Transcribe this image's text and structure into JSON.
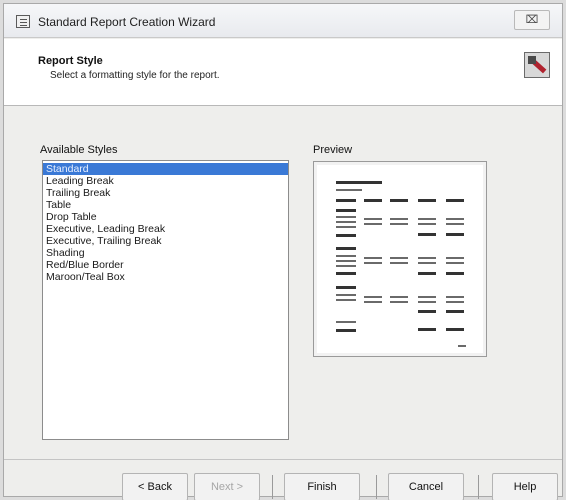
{
  "window": {
    "title": "Standard Report Creation Wizard",
    "close_label": "⌧"
  },
  "header": {
    "title": "Report Style",
    "subtitle": "Select a formatting style for the report.",
    "icon": "report-style-wand-icon"
  },
  "styles": {
    "label": "Available Styles",
    "items": [
      "Standard",
      "Leading Break",
      "Trailing Break",
      "Table",
      "Drop Table",
      "Executive, Leading Break",
      "Executive, Trailing Break",
      "Shading",
      "Red/Blue Border",
      "Maroon/Teal Box"
    ],
    "selected": "Standard"
  },
  "preview": {
    "label": "Preview"
  },
  "buttons": {
    "back": "< Back",
    "next": "Next >",
    "finish": "Finish",
    "cancel": "Cancel",
    "help": "Help"
  },
  "colors": {
    "selection": "#3a79d6",
    "header_background": "#ffffff",
    "dialog_background": "#eeeeec"
  }
}
